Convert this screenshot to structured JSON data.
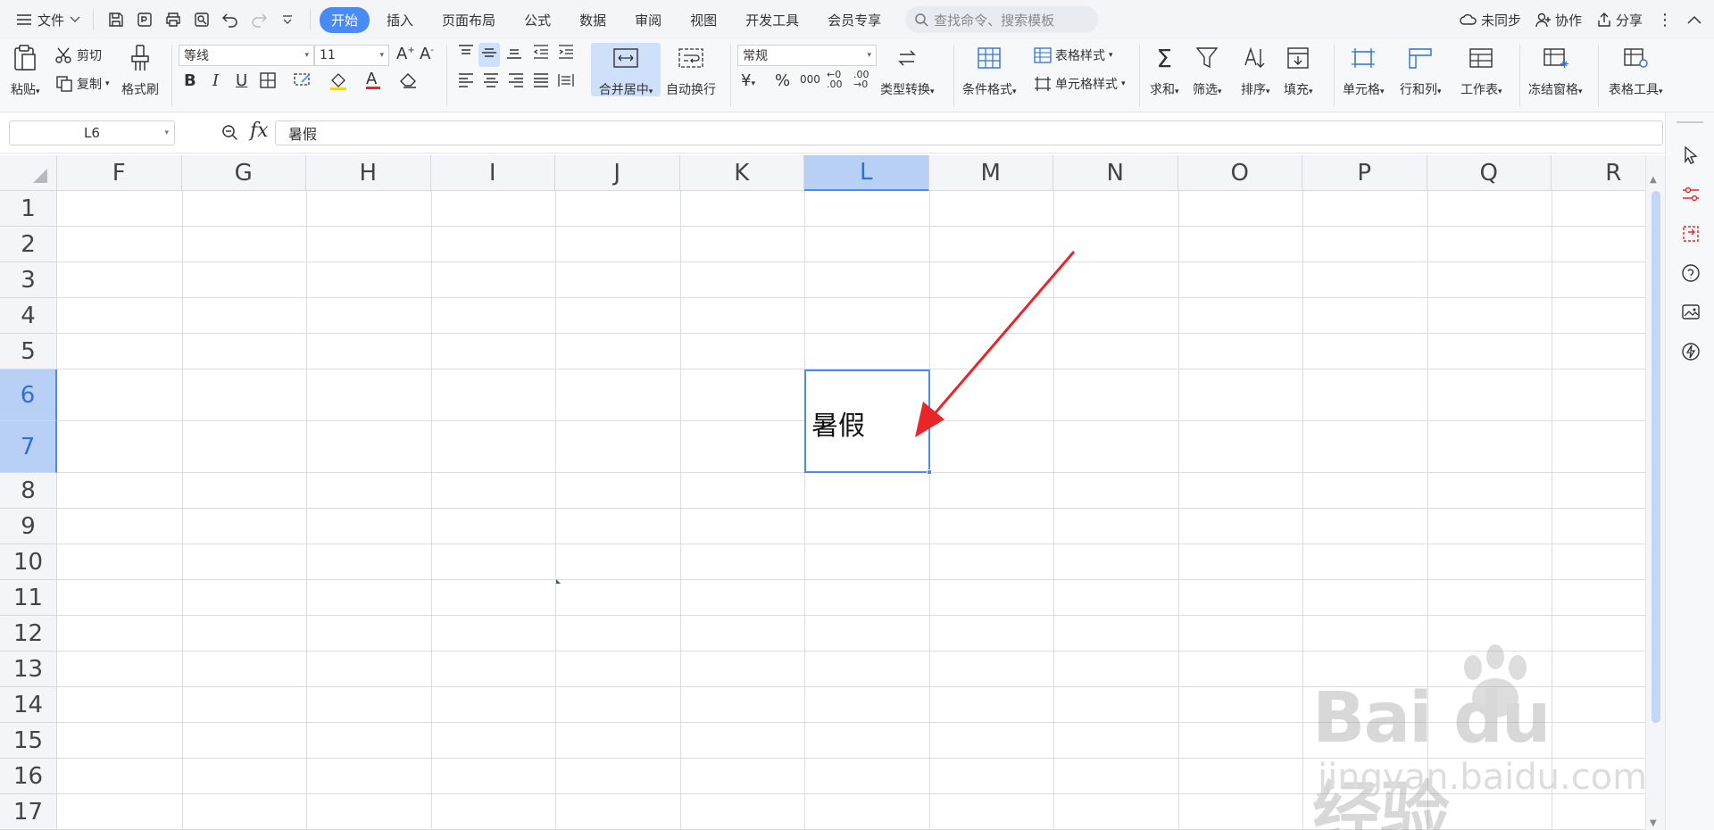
{
  "menubar": {
    "file_label": "文件",
    "tabs": [
      {
        "label": "开始",
        "active": true
      },
      {
        "label": "插入",
        "active": false
      },
      {
        "label": "页面布局",
        "active": false
      },
      {
        "label": "公式",
        "active": false
      },
      {
        "label": "数据",
        "active": false
      },
      {
        "label": "审阅",
        "active": false
      },
      {
        "label": "视图",
        "active": false
      },
      {
        "label": "开发工具",
        "active": false
      },
      {
        "label": "会员专享",
        "active": false
      }
    ],
    "search_placeholder": "查找命令、搜索模板",
    "sync_label": "未同步",
    "collab_label": "协作",
    "share_label": "分享"
  },
  "ribbon": {
    "paste": "粘贴",
    "cut": "剪切",
    "copy": "复制",
    "format_painter": "格式刷",
    "font_name": "等线",
    "font_size": "11",
    "merge_center": "合并居中",
    "wrap_text": "自动换行",
    "number_format": "常规",
    "type_convert": "类型转换",
    "conditional_format": "条件格式",
    "table_style": "表格样式",
    "cell_style": "单元格样式",
    "sum": "求和",
    "filter": "筛选",
    "sort": "排序",
    "fill": "填充",
    "cell": "单元格",
    "row_col": "行和列",
    "worksheet": "工作表",
    "freeze": "冻结窗格",
    "table_tools": "表格工具",
    "currency_symbol": "¥",
    "percent_symbol": "%",
    "thousands": "000"
  },
  "formula": {
    "name_box": "L6",
    "fx_label": "fx",
    "content": "暑假"
  },
  "sheet": {
    "columns": [
      "F",
      "G",
      "H",
      "I",
      "J",
      "K",
      "L",
      "M",
      "N",
      "O",
      "P",
      "Q",
      "R"
    ],
    "rows": [
      "1",
      "2",
      "3",
      "4",
      "5",
      "6",
      "7",
      "8",
      "9",
      "10",
      "11",
      "12",
      "13",
      "14",
      "15",
      "16",
      "17"
    ],
    "selected_column": "L",
    "selected_rows": [
      "6",
      "7"
    ],
    "selected_cell_text": "暑假"
  },
  "colors": {
    "accent": "#4a8af4",
    "arrow": "#e8262a",
    "selection_header": "#b8d0f6"
  },
  "watermark": {
    "logo": "Bai du 经验",
    "url": "jingyan.baidu.com"
  }
}
